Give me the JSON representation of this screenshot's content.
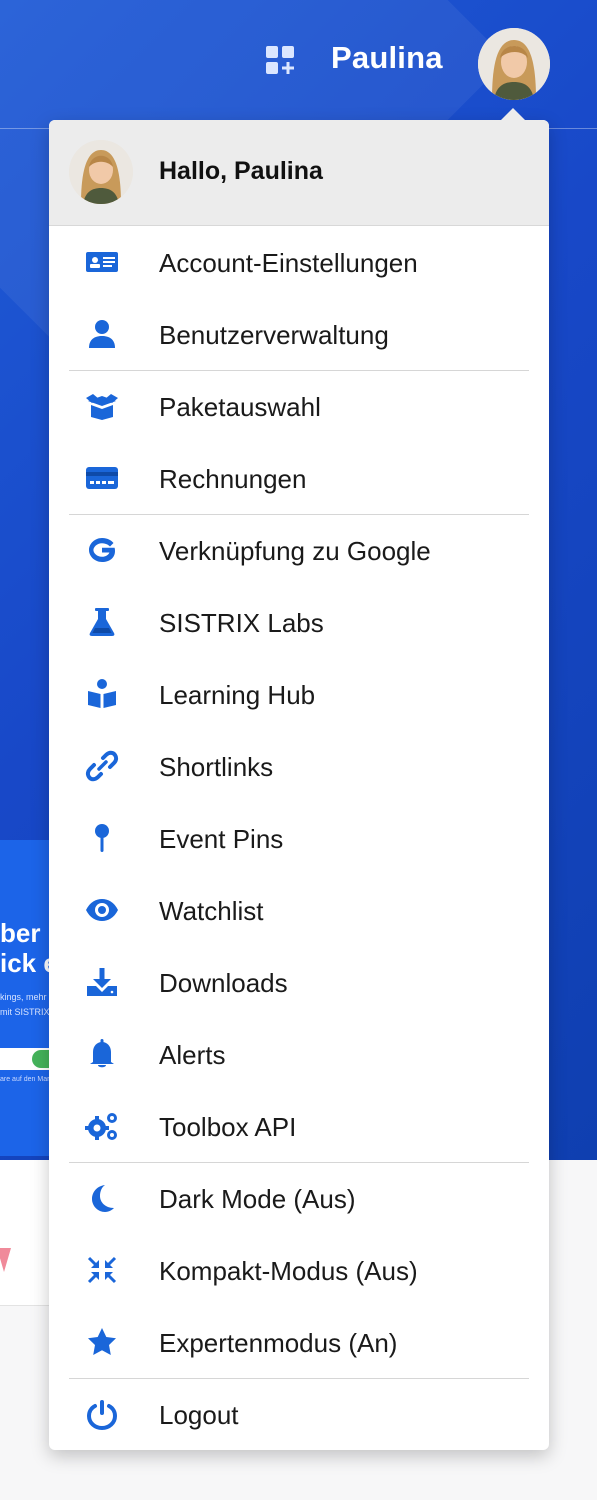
{
  "topbar": {
    "user_name": "Paulina",
    "apps_icon": "apps-add-icon",
    "avatar": "user-avatar"
  },
  "background_card": {
    "line1": "ber is",
    "line2": "ick er",
    "small1": "kings, mehr",
    "small2": "mit SISTRIX",
    "small3": "are auf den Mark"
  },
  "menu": {
    "greeting": "Hallo, Paulina",
    "accent_color": "#1a66d9",
    "items": [
      {
        "label": "Account-Einstellungen",
        "icon": "id-card-icon"
      },
      {
        "label": "Benutzerverwaltung",
        "icon": "user-icon"
      },
      {
        "label": "Paketauswahl",
        "icon": "box-open-icon"
      },
      {
        "label": "Rechnungen",
        "icon": "credit-card-icon"
      },
      {
        "label": "Verknüpfung zu Google",
        "icon": "google-icon"
      },
      {
        "label": "SISTRIX Labs",
        "icon": "flask-icon"
      },
      {
        "label": "Learning Hub",
        "icon": "book-reader-icon"
      },
      {
        "label": "Shortlinks",
        "icon": "link-icon"
      },
      {
        "label": "Event Pins",
        "icon": "pin-icon"
      },
      {
        "label": "Watchlist",
        "icon": "eye-icon"
      },
      {
        "label": "Downloads",
        "icon": "download-icon"
      },
      {
        "label": "Alerts",
        "icon": "bell-icon"
      },
      {
        "label": "Toolbox API",
        "icon": "gears-icon"
      },
      {
        "label": "Dark Mode (Aus)",
        "icon": "moon-icon"
      },
      {
        "label": "Kompakt-Modus (Aus)",
        "icon": "compress-icon"
      },
      {
        "label": "Expertenmodus (An)",
        "icon": "star-icon"
      },
      {
        "label": "Logout",
        "icon": "power-icon"
      }
    ]
  }
}
